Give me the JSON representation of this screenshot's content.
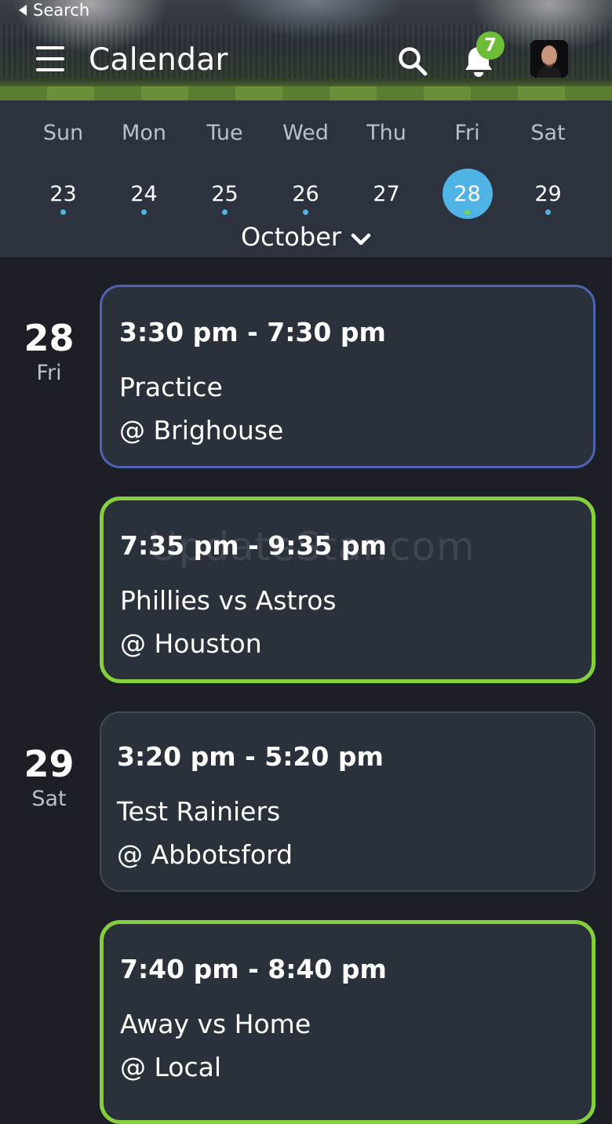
{
  "header": {
    "back_label": "Search",
    "title": "Calendar",
    "notification_count": "7",
    "icons": [
      "menu-icon",
      "search-icon",
      "bell-icon",
      "avatar"
    ]
  },
  "week": {
    "days": [
      {
        "name": "Sun",
        "num": "23",
        "has_events": true,
        "selected": false
      },
      {
        "name": "Mon",
        "num": "24",
        "has_events": true,
        "selected": false
      },
      {
        "name": "Tue",
        "num": "25",
        "has_events": true,
        "selected": false
      },
      {
        "name": "Wed",
        "num": "26",
        "has_events": true,
        "selected": false
      },
      {
        "name": "Thu",
        "num": "27",
        "has_events": false,
        "selected": false
      },
      {
        "name": "Fri",
        "num": "28",
        "has_events": true,
        "selected": true
      },
      {
        "name": "Sat",
        "num": "29",
        "has_events": true,
        "selected": false
      }
    ],
    "month": "October"
  },
  "agenda": {
    "dates": [
      {
        "num": "28",
        "dow": "Fri"
      },
      {
        "num": "29",
        "dow": "Sat"
      }
    ],
    "events": [
      {
        "time": "3:30 pm - 7:30 pm",
        "name": "Practice",
        "location": "@ Brighouse",
        "type": "practice"
      },
      {
        "time": "7:35 pm - 9:35 pm",
        "name": "Phillies vs Astros",
        "location": "@ Houston",
        "type": "game"
      },
      {
        "time": "3:20 pm - 5:20 pm",
        "name": "Test Rainiers",
        "location": "@ Abbotsford",
        "type": "event"
      },
      {
        "time": "7:40 pm - 8:40 pm",
        "name": "Away vs Home",
        "location": "@ Local",
        "type": "game"
      }
    ]
  },
  "watermark": "UpdateStar.com",
  "colors": {
    "accent_blue": "#4fb3e6",
    "game_green": "#86cf3c",
    "practice_blue": "#4f63b3",
    "badge_green": "#6dbd36",
    "card_bg": "#2b313b",
    "page_bg": "#1c1f25"
  }
}
